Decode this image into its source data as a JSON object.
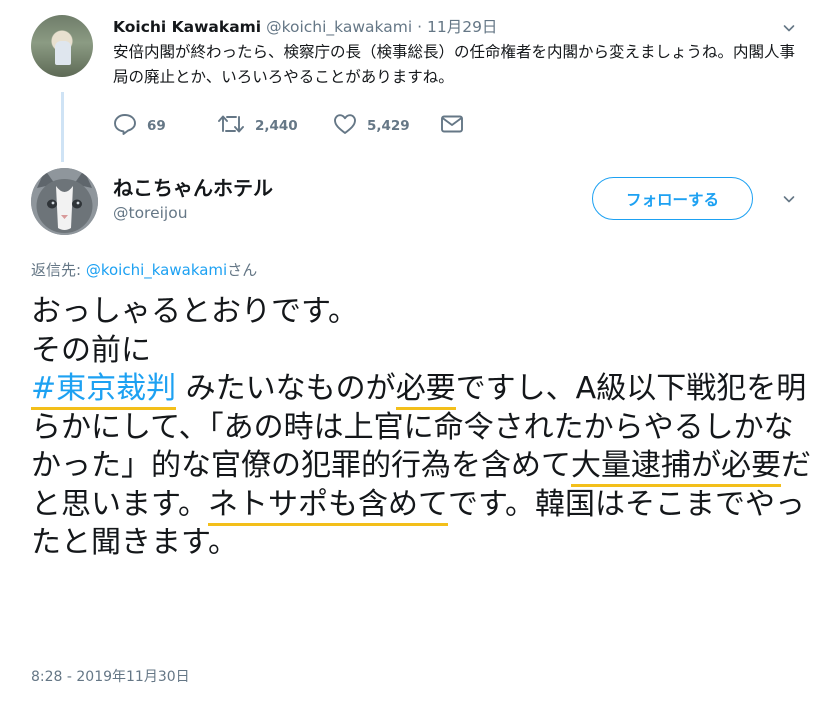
{
  "tweet1": {
    "name": "Koichi Kawakami",
    "handle": "@koichi_kawakami",
    "separator": "·",
    "date": "11月29日",
    "body": "安倍内閣が終わったら、検察庁の長（検事総長）の任命権者を内閣から変えましょうね。内閣人事局の廃止とか、いろいろやることがありますね。",
    "replies": "69",
    "retweets": "2,440",
    "likes": "5,429"
  },
  "tweet2": {
    "name": "ねこちゃんホテル",
    "handle": "@toreijou",
    "follow_label": "フォローする",
    "reply_prefix": "返信先: ",
    "reply_mention": "@koichi_kawakami",
    "reply_suffix": "さん",
    "body": {
      "line1": "おっしゃるとおりです。",
      "line2": "その前に",
      "hashtag": "#東京裁判",
      "seg_a": " みたいなものが",
      "ul_a": "必要",
      "seg_b": "ですし、A級以下戦犯を明らかにして、「あの時は上官に命令されたからやるしかなかった」的な官僚の犯罪的行為を含めて",
      "ul_b": "大量逮捕が必要",
      "seg_c": "だと思います。",
      "ul_c": "ネトサポも含めて",
      "seg_d": "です。韓国はそこまでやったと聞きます。"
    },
    "timestamp": "8:28 - 2019年11月30日"
  },
  "icons": {
    "reply": "reply-icon",
    "retweet": "retweet-icon",
    "like": "heart-icon",
    "dm": "envelope-icon",
    "menu": "chevron-down-icon"
  },
  "colors": {
    "accent": "#1da1f2",
    "muted": "#657786",
    "underline": "#f3bf1a",
    "thread_line": "#cfe3f5"
  }
}
